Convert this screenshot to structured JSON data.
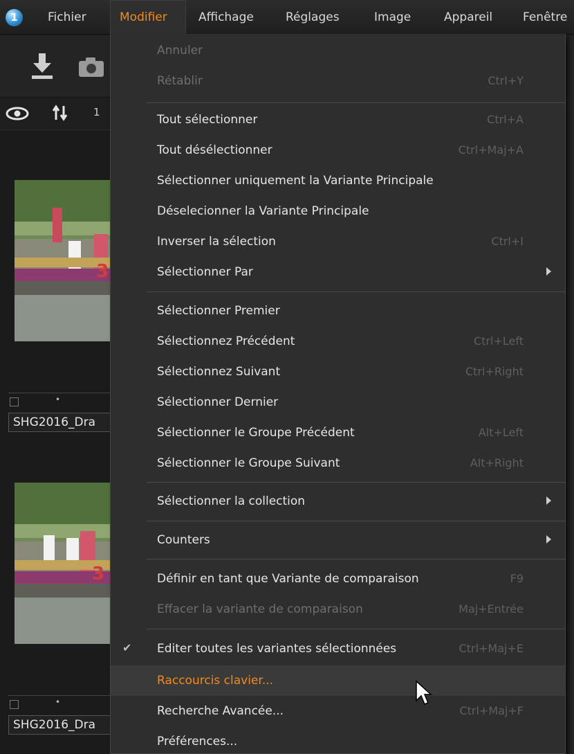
{
  "menubar": {
    "logo": "1",
    "items": [
      "Fichier",
      "Modifier",
      "Affichage",
      "Réglages",
      "Image",
      "Appareil",
      "Fenêtre"
    ]
  },
  "toolbar": {
    "icons": [
      "import-icon",
      "camera-icon"
    ]
  },
  "viewbar": {
    "icons": [
      "eye-icon",
      "sort-icon"
    ],
    "count": "1"
  },
  "thumbnails": [
    {
      "name": "SHG2016_Dra"
    },
    {
      "name": "SHG2016_Dra"
    }
  ],
  "dropdown": {
    "items": [
      {
        "label": "Annuler",
        "shortcut": "",
        "disabled": true
      },
      {
        "label": "Rétablir",
        "shortcut": "Ctrl+Y",
        "disabled": true
      },
      {
        "label": "Tout sélectionner",
        "shortcut": "Ctrl+A"
      },
      {
        "label": "Tout désélectionner",
        "shortcut": "Ctrl+Maj+A"
      },
      {
        "label": "Sélectionner uniquement la Variante Principale",
        "shortcut": ""
      },
      {
        "label": "Déselecionner la Variante Principale",
        "shortcut": ""
      },
      {
        "label": "Inverser la sélection",
        "shortcut": "Ctrl+I"
      },
      {
        "label": "Sélectionner Par",
        "shortcut": "",
        "submenu": true
      },
      {
        "label": "Sélectionner Premier",
        "shortcut": ""
      },
      {
        "label": "Sélectionnez Précédent",
        "shortcut": "Ctrl+Left"
      },
      {
        "label": "Sélectionnez Suivant",
        "shortcut": "Ctrl+Right"
      },
      {
        "label": "Sélectionner Dernier",
        "shortcut": ""
      },
      {
        "label": "Sélectionner le Groupe Précédent",
        "shortcut": "Alt+Left"
      },
      {
        "label": "Sélectionner le Groupe Suivant",
        "shortcut": "Alt+Right"
      },
      {
        "label": "Sélectionner la collection",
        "shortcut": "",
        "submenu": true
      },
      {
        "label": "Counters",
        "shortcut": "",
        "submenu": true
      },
      {
        "label": "Définir en tant que Variante de comparaison",
        "shortcut": "F9"
      },
      {
        "label": "Effacer la variante de comparaison",
        "shortcut": "Maj+Entrée",
        "disabled": true
      },
      {
        "label": "Editer toutes les variantes sélectionnées",
        "shortcut": "Ctrl+Maj+E",
        "checked": true
      },
      {
        "label": "Raccourcis clavier...",
        "shortcut": "",
        "highlighted": true
      },
      {
        "label": "Recherche Avancée...",
        "shortcut": "Ctrl+Maj+F"
      },
      {
        "label": "Préférences...",
        "shortcut": ""
      }
    ]
  },
  "colors": {
    "accent": "#f28a1e",
    "menu_bg": "#2e2e2e",
    "disabled_text": "#6e6e6e"
  }
}
